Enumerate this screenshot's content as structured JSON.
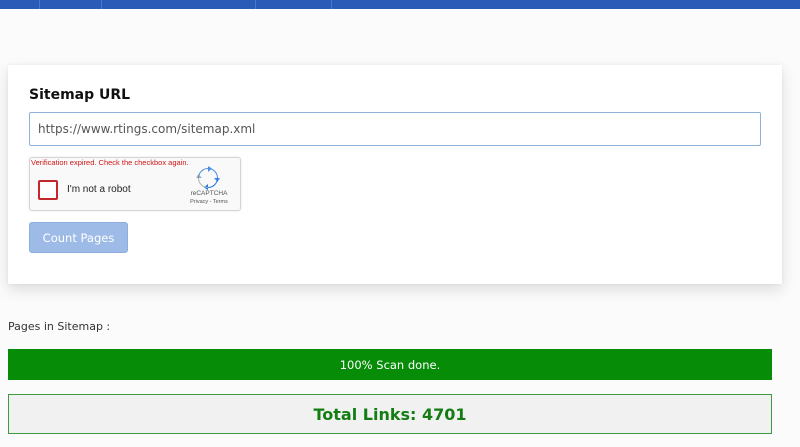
{
  "form": {
    "title": "Sitemap URL",
    "url_value": "https://www.rtings.com/sitemap.xml",
    "count_button_label": "Count Pages"
  },
  "captcha": {
    "error_text": "Verification expired. Check the checkbox again.",
    "checkbox_label": "I'm not a robot",
    "brand": "reCAPTCHA",
    "links": "Privacy - Terms",
    "checked": false
  },
  "results": {
    "pages_label": "Pages in Sitemap :",
    "progress_text": "100% Scan done.",
    "progress_percent": 100,
    "total_links": "Total Links: 4701"
  },
  "colors": {
    "topbar": "#2a5bb6",
    "progress_fill": "#078c07",
    "total_text": "#137d13",
    "captcha_error": "#d01717"
  }
}
